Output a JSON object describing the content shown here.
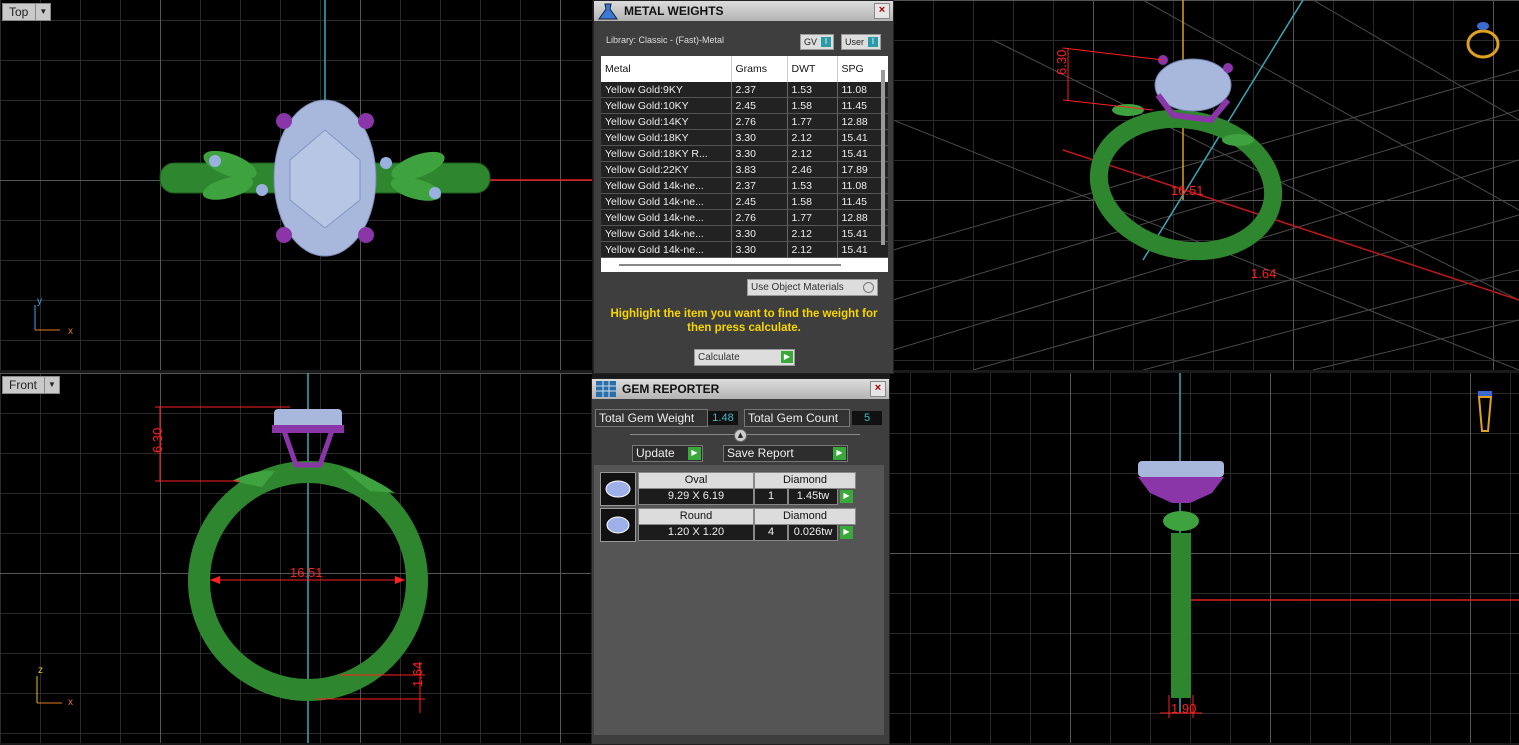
{
  "viewports": {
    "top": {
      "label": "Top",
      "axis_v": "y",
      "axis_h": "x"
    },
    "front": {
      "label": "Front",
      "axis_v": "z",
      "axis_h": "x",
      "dims": {
        "height": "6.30",
        "diameter": "16.51",
        "band": "1.64"
      }
    },
    "perspective": {
      "dims": {
        "height": "6.30",
        "diameter": "16.51",
        "band": "1.64"
      }
    },
    "right": {
      "dims": {
        "width": "1.90"
      }
    }
  },
  "metal_weights": {
    "title": "METAL WEIGHTS",
    "library": "Library: Classic - (Fast)-Metal",
    "toggle_gv": "GV",
    "toggle_user": "User",
    "toggle_indicator": "I",
    "columns": [
      "Metal",
      "Grams",
      "DWT",
      "SPG"
    ],
    "rows": [
      [
        "Yellow Gold:9KY",
        "2.37",
        "1.53",
        "11.08"
      ],
      [
        "Yellow Gold:10KY",
        "2.45",
        "1.58",
        "11.45"
      ],
      [
        "Yellow Gold:14KY",
        "2.76",
        "1.77",
        "12.88"
      ],
      [
        "Yellow Gold:18KY",
        "3.30",
        "2.12",
        "15.41"
      ],
      [
        "Yellow Gold:18KY R...",
        "3.30",
        "2.12",
        "15.41"
      ],
      [
        "Yellow Gold:22KY",
        "3.83",
        "2.46",
        "17.89"
      ],
      [
        "Yellow Gold 14k-ne...",
        "2.37",
        "1.53",
        "11.08"
      ],
      [
        "Yellow Gold 14k-ne...",
        "2.45",
        "1.58",
        "11.45"
      ],
      [
        "Yellow Gold 14k-ne...",
        "2.76",
        "1.77",
        "12.88"
      ],
      [
        "Yellow Gold 14k-ne...",
        "3.30",
        "2.12",
        "15.41"
      ],
      [
        "Yellow Gold 14k-ne...",
        "3.30",
        "2.12",
        "15.41"
      ]
    ],
    "use_object_materials": "Use Object Materials",
    "message": "Highlight the item you want to find the weight for then press calculate.",
    "calculate_label": "Calculate"
  },
  "gem_reporter": {
    "title": "GEM REPORTER",
    "total_weight_label": "Total Gem Weight",
    "total_weight_value": "1.48",
    "total_count_label": "Total Gem Count",
    "total_count_value": "5",
    "update_label": "Update",
    "save_report_label": "Save Report",
    "gems": [
      {
        "shape": "Oval",
        "material": "Diamond",
        "size": "9.29 X 6.19",
        "count": "1",
        "weight": "1.45tw"
      },
      {
        "shape": "Round",
        "material": "Diamond",
        "size": "1.20 X 1.20",
        "count": "4",
        "weight": "0.026tw"
      }
    ]
  },
  "colors": {
    "metal": "#2f8a2f",
    "prong": "#8a35a8",
    "gem": "#a8b8dc",
    "dimension": "#ff2020",
    "message": "#f7d600"
  },
  "icons": {
    "view_cube_persp": "ring-icon",
    "view_cube_right": "ring-side-icon",
    "panel_logo_mw": "flask-icon",
    "panel_logo_gr": "gem-grid-icon"
  }
}
